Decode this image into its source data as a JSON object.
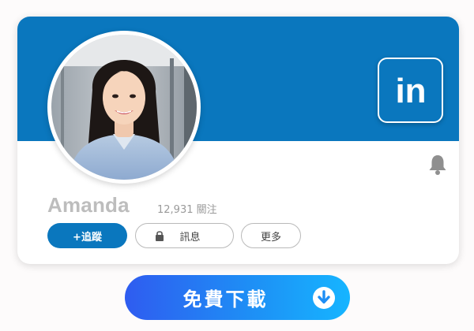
{
  "profile": {
    "name": "Amanda",
    "followers": "12,931 關注"
  },
  "actions": {
    "follow_label": "+追蹤",
    "message_label": "訊息",
    "more_label": "更多"
  },
  "download": {
    "label": "免費下載"
  },
  "brand": {
    "logo_text": "in"
  },
  "icons": {
    "brand": "linkedin-logo-icon",
    "notification": "bell-icon",
    "message": "lock-icon",
    "download": "download-arrow-icon"
  },
  "colors": {
    "brand_blue": "#0a77be",
    "name_gray": "#bdbdbd",
    "download_gradient_start": "#2f5cf0",
    "download_gradient_end": "#16b5ff"
  }
}
